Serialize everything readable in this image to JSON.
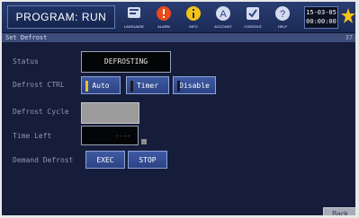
{
  "header": {
    "program_label": "PROGRAM:",
    "program_state": "RUN",
    "icons": [
      {
        "name": "language-icon",
        "label": "LANGUAGE"
      },
      {
        "name": "alarm-icon",
        "label": "ALARM"
      },
      {
        "name": "info-icon",
        "label": "INFO"
      },
      {
        "name": "account-icon",
        "label": "ACCOUNT"
      },
      {
        "name": "console-icon",
        "label": "CONSOLE"
      },
      {
        "name": "help-icon",
        "label": "HELP"
      }
    ],
    "clock_date": "15-03-05",
    "clock_time": "00:00:00"
  },
  "screen": {
    "title": "Set Defrost",
    "number": "37"
  },
  "fields": {
    "status_label": "Status",
    "status_value": "DEFROSTING",
    "ctrl_label": "Defrost CTRL",
    "ctrl_options": [
      "Auto",
      "Timer",
      "Disable"
    ],
    "cycle_label": "Defrost Cycle",
    "time_left_label": "Time Left",
    "time_left_value": "----",
    "demand_label": "Demand Defrost",
    "demand_exec": "EXEC",
    "demand_stop": "STOP"
  },
  "footer": {
    "back_label": "Back"
  },
  "colors": {
    "background": "#161d3a",
    "button": "#35509a",
    "auto_indicator": "#e8c232",
    "timer_indicator": "#1a1a1a",
    "disable_indicator": "#1a1a1a"
  }
}
